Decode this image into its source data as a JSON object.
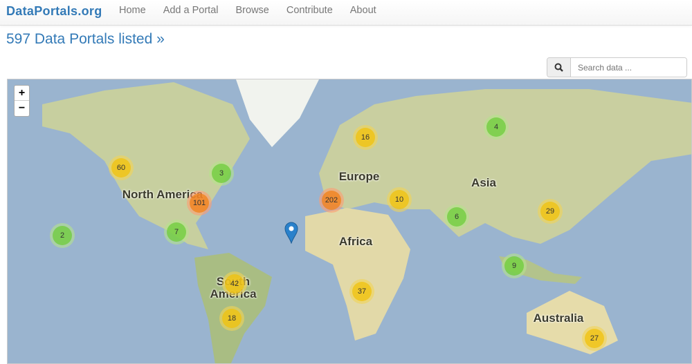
{
  "navbar": {
    "brand": "DataPortals.org",
    "links": [
      "Home",
      "Add a Portal",
      "Browse",
      "Contribute",
      "About"
    ]
  },
  "headline": "597 Data Portals listed »",
  "search": {
    "placeholder": "Search data ...",
    "icon": "search-icon"
  },
  "map": {
    "zoom_in": "+",
    "zoom_out": "−",
    "labels": [
      "North America",
      "Europe",
      "Asia",
      "Africa",
      "South America",
      "Australia"
    ],
    "clusters": [
      {
        "count": "60",
        "size": "medium"
      },
      {
        "count": "3",
        "size": "small"
      },
      {
        "count": "101",
        "size": "large"
      },
      {
        "count": "7",
        "size": "small"
      },
      {
        "count": "2",
        "size": "small"
      },
      {
        "count": "42",
        "size": "medium"
      },
      {
        "count": "18",
        "size": "medium"
      },
      {
        "count": "16",
        "size": "medium"
      },
      {
        "count": "202",
        "size": "large"
      },
      {
        "count": "10",
        "size": "medium"
      },
      {
        "count": "4",
        "size": "small"
      },
      {
        "count": "6",
        "size": "small"
      },
      {
        "count": "29",
        "size": "medium"
      },
      {
        "count": "9",
        "size": "small"
      },
      {
        "count": "37",
        "size": "medium"
      },
      {
        "count": "27",
        "size": "medium"
      }
    ],
    "colors": {
      "ocean": "#9ab4cf",
      "marker": "#2a81cb"
    }
  }
}
